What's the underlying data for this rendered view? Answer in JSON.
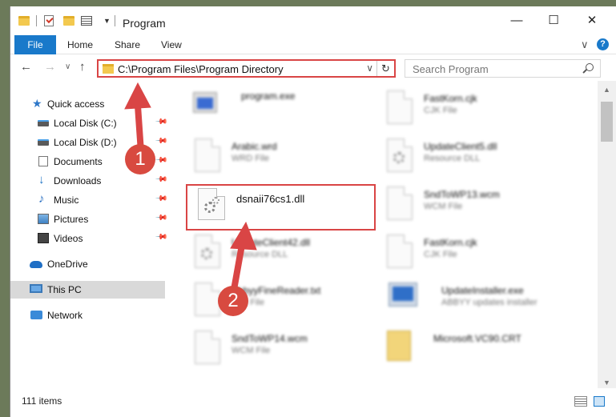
{
  "window": {
    "title": "Program",
    "minimize": "—",
    "maximize": "☐",
    "close": "✕"
  },
  "ribbon": {
    "tabs": [
      "File",
      "Home",
      "Share",
      "View"
    ],
    "expand": "∨",
    "help": "?"
  },
  "nav": {
    "back": "←",
    "forward": "→",
    "recent": "∨",
    "up": "↑",
    "address": "C:\\Program Files\\Program Directory",
    "address_caret": "∨",
    "refresh": "↻",
    "search_placeholder": "Search Program"
  },
  "sidebar": {
    "items": [
      {
        "label": "Quick access"
      },
      {
        "label": "Local Disk (C:)",
        "pin": "📌"
      },
      {
        "label": "Local Disk (D:)",
        "pin": "📌"
      },
      {
        "label": "Documents",
        "pin": "📌"
      },
      {
        "label": "Downloads",
        "pin": "📌"
      },
      {
        "label": "Music",
        "pin": "📌"
      },
      {
        "label": "Pictures",
        "pin": "📌"
      },
      {
        "label": "Videos",
        "pin": "📌"
      },
      {
        "label": "OneDrive"
      },
      {
        "label": "This PC"
      },
      {
        "label": "Network"
      }
    ]
  },
  "files": [
    {
      "name": "program.exe",
      "type": ""
    },
    {
      "name": "FastKorn.cjk",
      "type": "CJK File"
    },
    {
      "name": "Arabic.wrd",
      "type": "WRD File"
    },
    {
      "name": "UpdateClient5.dll",
      "type": "Resource DLL"
    },
    {
      "name": "dsnaii76cs1.dll",
      "type": ""
    },
    {
      "name": "SndToWP13.wcm",
      "type": "WCM File"
    },
    {
      "name": "UpdateClient42.dll",
      "type": "Resource DLL"
    },
    {
      "name": "FastKorn.cjk",
      "type": "CJK File"
    },
    {
      "name": "AbbyyFineReader.txt",
      "type": "Text File"
    },
    {
      "name": "UpdateInstaller.exe",
      "type": "ABBYY updates installer"
    },
    {
      "name": "SndToWP14.wcm",
      "type": "WCM File"
    },
    {
      "name": "Microsoft.VC90.CRT",
      "type": ""
    }
  ],
  "status": {
    "item_count": "111 items"
  },
  "annotations": {
    "step1": "1",
    "step2": "2",
    "color": "#d94545"
  }
}
